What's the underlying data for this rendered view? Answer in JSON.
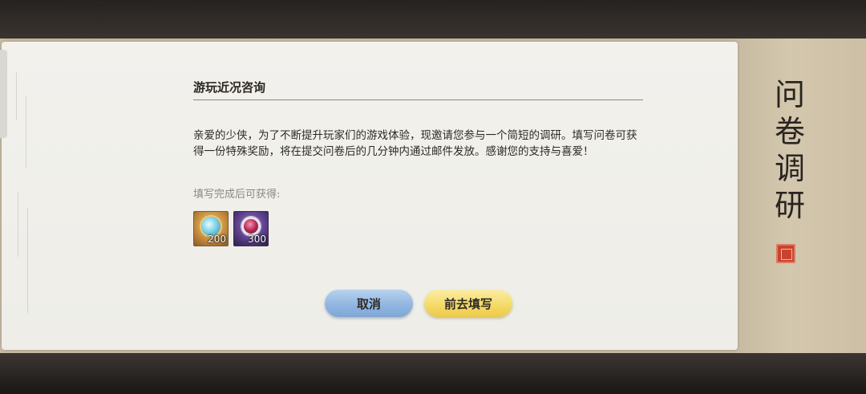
{
  "dialog": {
    "title": "游玩近况咨询",
    "body": "亲爱的少侠，为了不断提升玩家们的游戏体验，现邀请您参与一个简短的调研。填写问卷可获得一份特殊奖励，将在提交问卷后的几分钟内通过邮件发放。感谢您的支持与喜爱！",
    "reward_label": "填写完成后可获得:",
    "rewards": [
      {
        "icon": "blue-orb-item-icon",
        "count": "200"
      },
      {
        "icon": "dark-orb-item-icon",
        "count": "300"
      }
    ],
    "cancel_label": "取消",
    "confirm_label": "前去填写"
  },
  "side_panel": {
    "title_chars": [
      "问",
      "卷",
      "调",
      "研"
    ]
  },
  "colors": {
    "cancel_button": "#8fb4e0",
    "confirm_button": "#f4d965",
    "side_panel": "#cdbfa5",
    "seal": "#c8432e"
  }
}
